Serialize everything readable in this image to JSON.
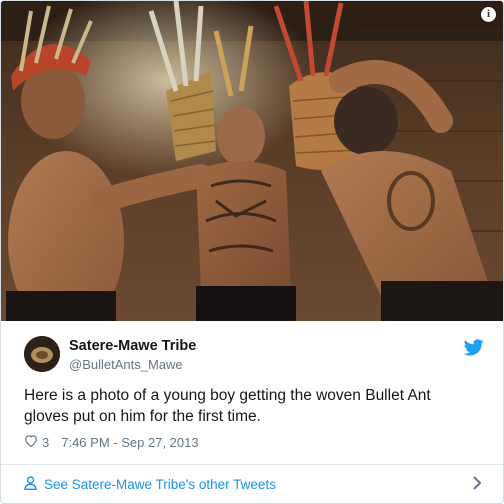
{
  "tweet": {
    "display_name": "Satere-Mawe Tribe",
    "handle": "@BulletAnts_Mawe",
    "text": "Here is a photo of a young boy getting the woven Bullet Ant gloves put on him for the first time.",
    "like_count": "3",
    "timestamp": "7:46 PM - Sep 27, 2013",
    "photo_alt": "photo",
    "info_label": "i"
  },
  "footer": {
    "link_label": "See Satere-Mawe Tribe's other Tweets"
  },
  "icons": {
    "info": "info-icon",
    "twitter": "twitter-bird-icon",
    "heart": "heart-icon",
    "person": "person-icon",
    "chevron": "chevron-right-icon"
  },
  "colors": {
    "link": "#1b95e0",
    "secondary_text": "#657786",
    "primary_text": "#14171a",
    "twitter_blue": "#1da1f2"
  }
}
